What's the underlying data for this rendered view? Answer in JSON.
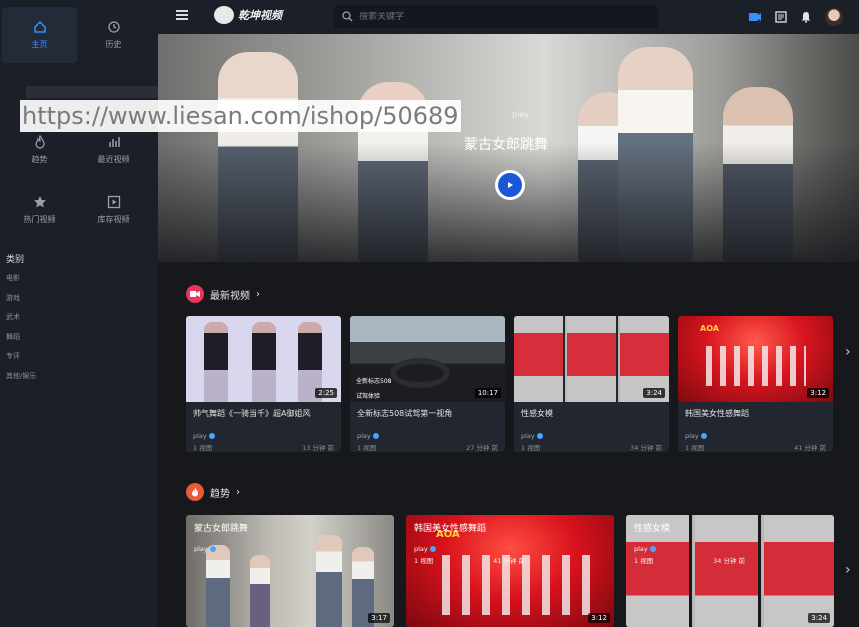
{
  "sidebar": {
    "nav": [
      {
        "label": "主页",
        "icon": "home-icon",
        "active": true
      },
      {
        "label": "历史",
        "icon": "history-icon",
        "active": false
      },
      {
        "label": "",
        "icon": "document-icon",
        "active": false
      },
      {
        "label": "",
        "icon": "video-camera-icon",
        "active": false
      },
      {
        "label": "趋势",
        "icon": "fire-icon",
        "active": false
      },
      {
        "label": "最近视频",
        "icon": "bar-chart-icon",
        "active": false
      },
      {
        "label": "热门视频",
        "icon": "star-icon",
        "active": false
      },
      {
        "label": "库存视频",
        "icon": "play-square-icon",
        "active": false
      }
    ],
    "category_title": "类别",
    "categories": [
      "电影",
      "游戏",
      "武术",
      "舞蹈",
      "专评",
      "其他/娱乐"
    ]
  },
  "header": {
    "logo_text": "乾坤视频",
    "search_placeholder": "搜索关键字"
  },
  "hero": {
    "author": "play",
    "title": "蒙古女郎跳舞"
  },
  "watermark": "https://www.liesan.com/ishop/50689",
  "colors": {
    "accent": "#3a8fff",
    "section_red": "#e8365a",
    "section_orange": "#e85a3a"
  },
  "latest": {
    "heading": "最新视频",
    "items": [
      {
        "title": "帅气舞蹈《一骑当千》超A御姐风",
        "author": "play",
        "views": "1 视图",
        "time": "13 分钟 前",
        "duration": "2:25"
      },
      {
        "title": "全新标志508试驾第一视角",
        "author": "play",
        "views": "1 视图",
        "time": "27 分钟 前",
        "duration": "10:17"
      },
      {
        "title": "性感女模",
        "author": "play",
        "views": "1 视图",
        "time": "34 分钟 前",
        "duration": "3:24"
      },
      {
        "title": "韩国美女性感舞蹈",
        "author": "play",
        "views": "1 视图",
        "time": "41 分钟 前",
        "duration": "3:12"
      }
    ]
  },
  "trending": {
    "heading": "趋势",
    "items": [
      {
        "title": "蒙古女郎跳舞",
        "author": "play",
        "views": "",
        "time": "",
        "duration": "3:17"
      },
      {
        "title": "韩国美女性感舞蹈",
        "author": "play",
        "views": "1 视图",
        "time": "41 分钟 前",
        "duration": "3:12"
      },
      {
        "title": "性感女模",
        "author": "play",
        "views": "1 视图",
        "time": "34 分钟 前",
        "duration": "3:24"
      }
    ]
  },
  "thumb_overlays": {
    "car_badge": "全新标志508",
    "car_sub": "试驾体验",
    "aoa": "AOA"
  },
  "chevron": "›"
}
